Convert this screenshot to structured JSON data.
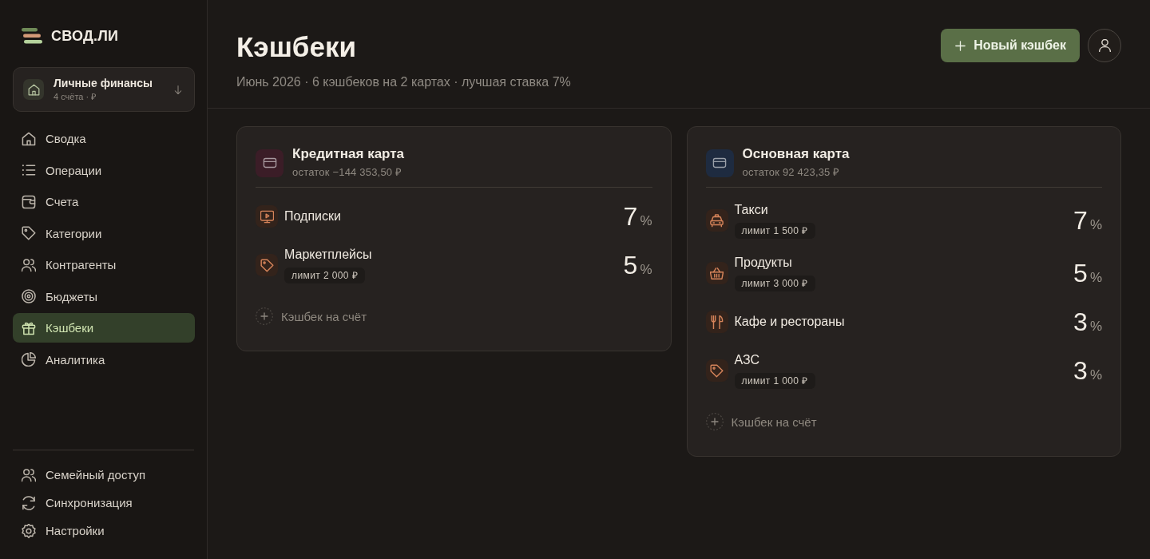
{
  "sidebar": {
    "logo": "СВОД.ЛИ",
    "workspace": {
      "name": "Личные финансы",
      "meta": "4 счёта · ₽"
    },
    "nav": [
      {
        "label": "Сводка",
        "selected": false
      },
      {
        "label": "Операции",
        "selected": false
      },
      {
        "label": "Счета",
        "selected": false
      },
      {
        "label": "Категории",
        "selected": false
      },
      {
        "label": "Контрагенты",
        "selected": false
      },
      {
        "label": "Бюджеты",
        "selected": false
      },
      {
        "label": "Кэшбеки",
        "selected": true
      },
      {
        "label": "Аналитика",
        "selected": false
      }
    ],
    "footer_nav": [
      {
        "label": "Семейный доступ",
        "selected": false
      },
      {
        "label": "Синхронизация",
        "selected": false
      },
      {
        "label": "Настройки",
        "selected": false
      }
    ]
  },
  "header": {
    "title": "Кэшбеки",
    "subtitle": "Июнь 2026 · 6 кэшбеков на 2 картах · лучшая ставка 7%",
    "new_button": "Новый кэшбек"
  },
  "cards": [
    {
      "title": "Кредитная карта",
      "balance": "остаток −144 353,50 ₽",
      "color": "#3b1d27",
      "cashbacks": [
        {
          "kind": "subscriptions",
          "name": "Подписки",
          "rate": "7",
          "unit": "%"
        },
        {
          "kind": "marketplaces",
          "name": "Маркетплейсы",
          "limit": "лимит 2 000 ₽",
          "rate": "5",
          "unit": "%"
        }
      ],
      "add_button": "Кэшбек на счёт"
    },
    {
      "title": "Основная карта",
      "balance": "остаток 92 423,35 ₽",
      "color": "#1e2b40",
      "cashbacks": [
        {
          "kind": "taxi",
          "name": "Такси",
          "limit": "лимит 1 500 ₽",
          "rate": "7",
          "unit": "%"
        },
        {
          "kind": "groceries",
          "name": "Продукты",
          "limit": "лимит 3 000 ₽",
          "rate": "5",
          "unit": "%"
        },
        {
          "kind": "restaurants",
          "name": "Кафе и рестораны",
          "rate": "3",
          "unit": "%"
        },
        {
          "kind": "fuel",
          "name": "АЗС",
          "limit": "лимит 1 000 ₽",
          "rate": "3",
          "unit": "%"
        }
      ],
      "add_button": "Кэшбек на счёт"
    }
  ]
}
